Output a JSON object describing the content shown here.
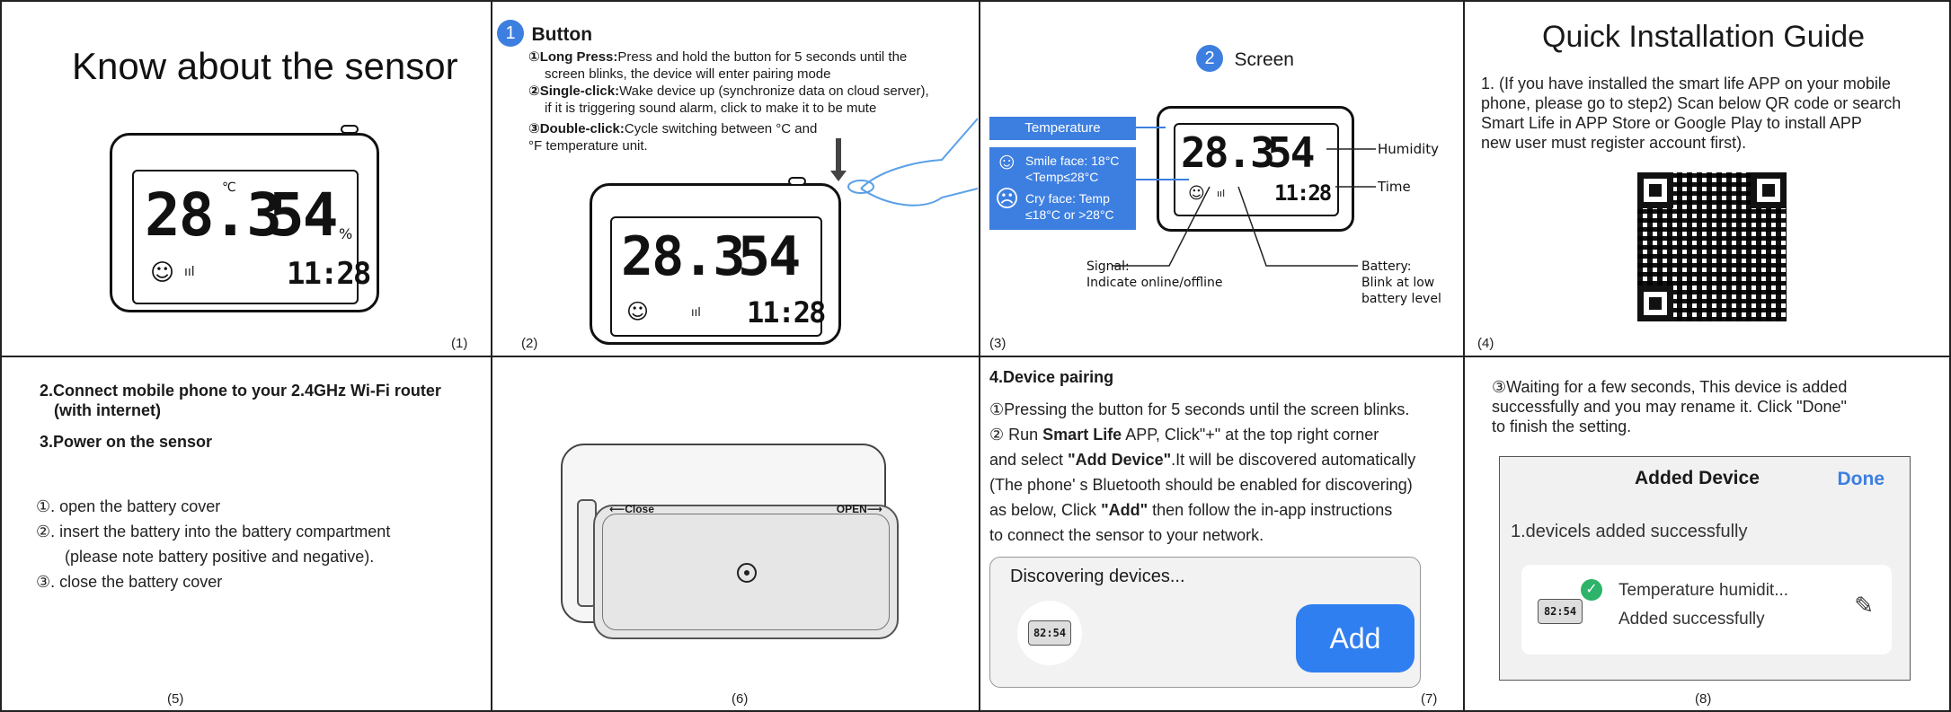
{
  "panel1": {
    "title": "Know about the sensor",
    "num": "(1)",
    "temp": "28.3",
    "hum": "54",
    "time": "11:28",
    "unit": "℃",
    "pct": "%",
    "smile": "☺",
    "sig": "ııl"
  },
  "panel2": {
    "step": "1",
    "title": "Button",
    "lines": [
      {
        "k": "①Long Press:",
        "v": "Press and hold the button for 5 seconds until the"
      },
      {
        "k": "",
        "v": "screen blinks, the device will enter pairing mode"
      },
      {
        "k": "②Single-click:",
        "v": "Wake device up (synchronize data on cloud server),"
      },
      {
        "k": "",
        "v": "if it is triggering sound alarm, click to make it to be mute"
      },
      {
        "k": "③Double-click:",
        "v": "Cycle switching between °C and"
      },
      {
        "k": "",
        "v": "°F temperature unit."
      }
    ],
    "num": "(2)",
    "temp": "28.3",
    "hum": "54",
    "time": "11:28"
  },
  "panel3": {
    "step": "2",
    "title": "Screen",
    "temperature": "Temperature",
    "smile_face": "Smile face: 18°C",
    "smile_face2": "<Temp≤28°C",
    "cry_face": "Cry face: Temp",
    "cry_face2": "≤18°C or >28°C",
    "humidity": "Humidity",
    "time": "Time",
    "signal": "Signal:",
    "signal2": "Indicate online/offline",
    "battery": "Battery:",
    "battery2": "Blink at low",
    "battery3": "battery level",
    "num": "(3)",
    "temp": "28.3",
    "hum": "54",
    "clock": "11:28"
  },
  "panel4": {
    "title": "Quick Installation Guide",
    "text": [
      "1. (If you have installed the smart life APP on your mobile",
      "phone, please go to step2) Scan below QR code or search",
      "Smart Life in APP Store or Google Play to install APP",
      "new user must register account first)."
    ],
    "num": "(4)"
  },
  "panel5": {
    "h1": "2.Connect mobile phone to your 2.4GHz Wi-Fi router",
    "h1b": "(with internet)",
    "h2": "3.Power on the sensor",
    "items": [
      "①. open the battery cover",
      "②. insert the battery into the battery compartment",
      "(please note battery positive and negative).",
      "③. close the battery cover"
    ],
    "num": "(5)"
  },
  "panel6": {
    "close": "⟵Close",
    "open": "OPEN⟶",
    "num": "(6)"
  },
  "panel7": {
    "title": "4.Device pairing",
    "l1": "①Pressing the button for 5 seconds until the screen blinks.",
    "l2a": "② Run ",
    "l2b": "Smart Life",
    "l2c": " APP, Click\"+\" at the top right corner",
    "l3a": "and select ",
    "l3b": "\"Add Device\"",
    "l3c": ".It will be discovered automatically",
    "l4": "(The phone' s Bluetooth should be enabled for discovering)",
    "l5a": "as below, Click ",
    "l5b": "\"Add\"",
    "l5c": " then follow the in-app instructions",
    "l6": "to connect the sensor to your network.",
    "card_title": "Discovering devices...",
    "add": "Add",
    "mini": "82:54",
    "num": "(7)"
  },
  "panel8": {
    "text": [
      "③Waiting for a few seconds, This device is added",
      "successfully and you may rename it. Click \"Done\"",
      "to finish the setting."
    ],
    "header": "Added Device",
    "done": "Done",
    "added": "1.devicels added successfully",
    "dev": "Temperature humidit...",
    "status": "Added successfully",
    "mini": "82:54",
    "num": "(8)"
  }
}
